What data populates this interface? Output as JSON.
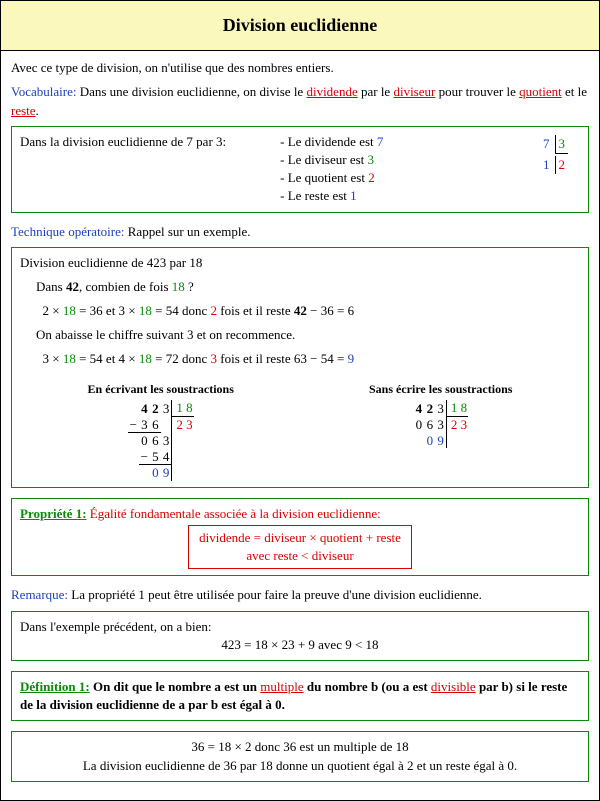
{
  "title": "Division euclidienne",
  "intro": "Avec ce type de division, on n'utilise que des nombres entiers.",
  "vocab_label": "Vocabulaire:",
  "vocab_text_1": " Dans une division euclidienne, on divise le ",
  "vocab_dividende": "dividende",
  "vocab_text_2": " par le ",
  "vocab_diviseur": "diviseur",
  "vocab_text_3": " pour trouver le ",
  "vocab_quotient": "quotient",
  "vocab_text_4": " et le ",
  "vocab_reste": "reste",
  "vocab_text_5": ".",
  "box1": {
    "lead": "Dans la division euclidienne de 7 par 3:",
    "l1a": "- Le dividende est ",
    "l1b": "7",
    "l2a": "- Le diviseur est ",
    "l2b": "3",
    "l3a": "- Le quotient est ",
    "l3b": "2",
    "l4a": "- Le reste est ",
    "l4b": "1",
    "mini": {
      "a": "7",
      "b": "3",
      "r": "1",
      "q": "2"
    }
  },
  "tech_label": "Technique opératoire:",
  "tech_text": " Rappel sur un exemple.",
  "box2": {
    "head": "Division euclidienne de 423 par 18",
    "q1a": "Dans ",
    "q1b": "42",
    "q1c": ", combien de fois ",
    "q1d": "18",
    "q1e": " ?",
    "line2_a": "2 × ",
    "line2_b": "18",
    "line2_c": " = 36   et   3 × ",
    "line2_d": "18",
    "line2_e": " = 54   donc  ",
    "line2_f": "2",
    "line2_g": " fois  et  il reste  ",
    "line2_h": "42",
    "line2_i": " − 36 = 6",
    "abaisse": "On abaisse le chiffre suivant 3 et on recommence.",
    "line3_a": "3 × ",
    "line3_b": "18",
    "line3_c": " = 54   et   4 × ",
    "line3_d": "18",
    "line3_e": " = 72   donc  ",
    "line3_f": "3",
    "line3_g": " fois  et  il reste  63 − 54 = ",
    "line3_h": "9",
    "h1": "En écrivant les soustractions",
    "h2": "Sans écrire les soustractions",
    "ld": {
      "d1": "4",
      "d2": "2",
      "d3": "3",
      "dv": "1 8",
      "s1a": "3",
      "s1b": "6",
      "q": "2 3",
      "b1": "0",
      "b2": "6",
      "b3": "3",
      "s2a": "5",
      "s2b": "4",
      "r1": "0",
      "r2": "9"
    }
  },
  "prop_label": "Propriété 1:",
  "prop_text": " Égalité fondamentale associée à la division euclidienne:",
  "prop_eq1": "dividende = diviseur × quotient + reste",
  "prop_eq2": "avec  reste < diviseur",
  "remarque_label": "Remarque:",
  "remarque_text": " La propriété 1 peut être utilisée pour faire la preuve d'une division euclidienne.",
  "box3": {
    "lead": "Dans l'exemple précédent, on a bien:",
    "eq": "423 = 18 × 23 + 9   avec   9 < 18"
  },
  "def_label": "Définition 1:",
  "def_a": " On dit que le nombre a est un ",
  "def_multiple": "multiple",
  "def_b": " du nombre b (ou  a est ",
  "def_divisible": "divisible",
  "def_c": " par b) si le reste de la division euclidienne de a par b est égal à 0.",
  "box5": {
    "l1": "36 = 18 × 2  donc  36 est un multiple de 18",
    "l2": "La division euclidienne de 36 par 18 donne un quotient égal à 2 et un reste égal à 0."
  }
}
